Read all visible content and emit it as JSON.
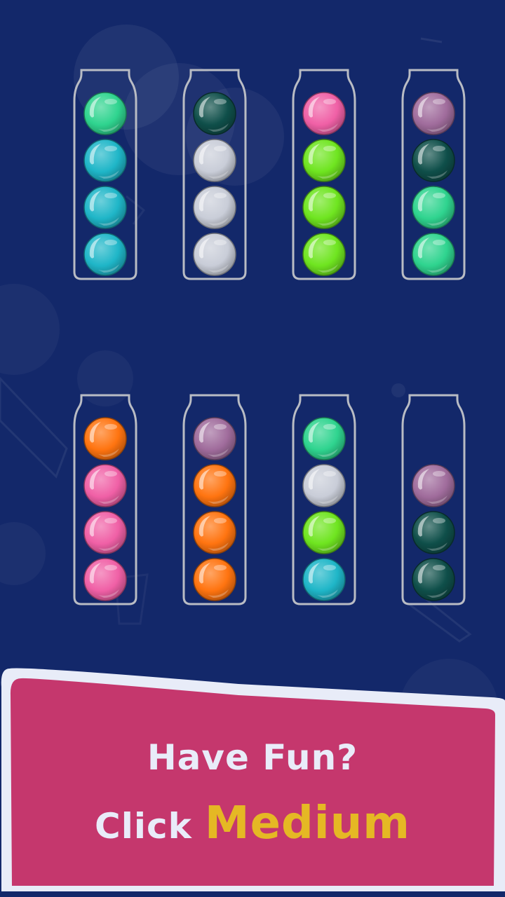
{
  "colors": {
    "background": "#13286a",
    "tube_outline": "#b9bcc4",
    "banner_fill": "#c5376d",
    "banner_border": "#e8ecf8",
    "prompt_text": "#e9ecf9",
    "highlight_text": "#e5b824"
  },
  "ball_colors": {
    "mint": "#2fd48f",
    "teal": "#1fb6c8",
    "dark-teal": "#0f4f4a",
    "silver": "#c9cdd8",
    "pink": "#f060a6",
    "lime": "#6fe520",
    "mauve": "#a06c9c",
    "orange": "#ff7410"
  },
  "tubes": [
    {
      "id": 1,
      "balls_top_to_bottom": [
        "mint",
        "teal",
        "teal",
        "teal"
      ]
    },
    {
      "id": 2,
      "balls_top_to_bottom": [
        "dark-teal",
        "silver",
        "silver",
        "silver"
      ]
    },
    {
      "id": 3,
      "balls_top_to_bottom": [
        "pink",
        "lime",
        "lime",
        "lime"
      ]
    },
    {
      "id": 4,
      "balls_top_to_bottom": [
        "mauve",
        "dark-teal",
        "mint",
        "mint"
      ]
    },
    {
      "id": 5,
      "balls_top_to_bottom": [
        "orange",
        "pink",
        "pink",
        "pink"
      ]
    },
    {
      "id": 6,
      "balls_top_to_bottom": [
        "mauve",
        "orange",
        "orange",
        "orange"
      ]
    },
    {
      "id": 7,
      "balls_top_to_bottom": [
        "mint",
        "silver",
        "lime",
        "teal"
      ]
    },
    {
      "id": 8,
      "balls_top_to_bottom": [
        "mauve",
        "dark-teal",
        "dark-teal"
      ]
    }
  ],
  "tube_capacity": 4,
  "banner": {
    "line1": "Have Fun?",
    "line2_prefix": "Click",
    "line2_highlight": "Medium"
  }
}
